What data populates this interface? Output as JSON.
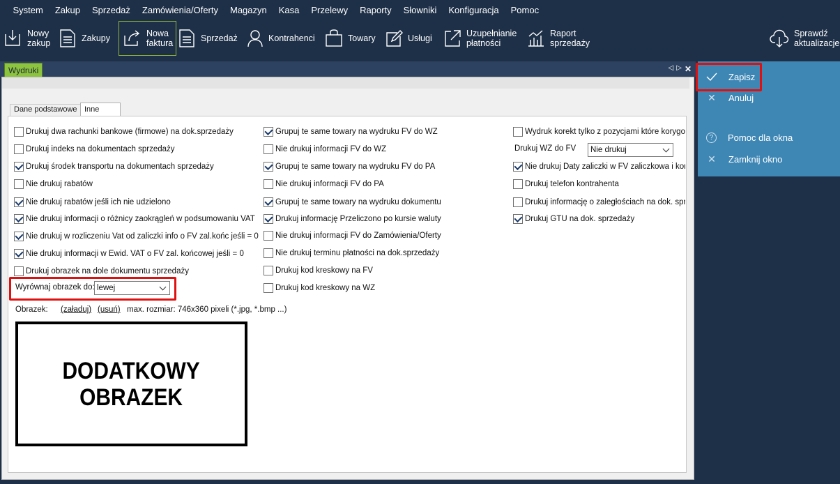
{
  "menu": [
    "System",
    "Zakup",
    "Sprzedaż",
    "Zamówienia/Oferty",
    "Magazyn",
    "Kasa",
    "Przelewy",
    "Raporty",
    "Słowniki",
    "Konfiguracja",
    "Pomoc"
  ],
  "toolbar": {
    "nowy_zakup": "Nowy\nzakup",
    "zakupy": "Zakupy",
    "nowa_faktura": "Nowa\nfaktura",
    "sprzedaz": "Sprzedaż",
    "kontrahenci": "Kontrahenci",
    "towary": "Towary",
    "uslugi": "Usługi",
    "uzupelnianie": "Uzupełnianie\npłatności",
    "raport": "Raport\nsprzedaży",
    "aktualizacje": "Sprawdź\naktualizacje"
  },
  "doc_tab": "Wydruki",
  "subtabs": {
    "basic": "Dane podstawowe",
    "other": "Inne"
  },
  "col1": [
    {
      "label": "Drukuj dwa rachunki bankowe (firmowe) na dok.sprzedaży",
      "checked": false
    },
    {
      "label": "Drukuj indeks na dokumentach sprzedaży",
      "checked": false
    },
    {
      "label": "Drukuj środek transportu na dokumentach sprzedaży",
      "checked": true
    },
    {
      "label": "Nie drukuj rabatów",
      "checked": false
    },
    {
      "label": "Nie drukuj rabatów jeśli ich nie udzielono",
      "checked": true
    },
    {
      "label": "Nie drukuj informacji o różnicy zaokrągleń w podsumowaniu VAT",
      "checked": true
    },
    {
      "label": "Nie drukuj w rozliczeniu Vat od zaliczki info o FV zal.końc jeśli = 0",
      "checked": true
    },
    {
      "label": "Nie drukuj informacji w Ewid. VAT o FV zal. końcowej jeśli = 0",
      "checked": true
    },
    {
      "label": "Drukuj obrazek na dole dokumentu sprzedaży",
      "checked": false
    }
  ],
  "col2": [
    {
      "label": "Grupuj te same towary na wydruku FV do WZ",
      "checked": true
    },
    {
      "label": "Nie drukuj informacji FV do WZ",
      "checked": false
    },
    {
      "label": "Grupuj te same towary na wydruku FV do PA",
      "checked": true
    },
    {
      "label": "Nie drukuj informacji FV do PA",
      "checked": false
    },
    {
      "label": "Grupuj te same towary na wydruku dokumentu",
      "checked": true
    },
    {
      "label": "Drukuj informację Przeliczono po kursie waluty",
      "checked": true
    },
    {
      "label": "Nie drukuj informacji FV do Zamówienia/Oferty",
      "checked": false
    },
    {
      "label": "Nie drukuj terminu płatności na dok.sprzedaży",
      "checked": false
    },
    {
      "label": "Drukuj kod kreskowy na FV",
      "checked": false
    },
    {
      "label": "Drukuj kod kreskowy na WZ",
      "checked": false
    }
  ],
  "col3": [
    {
      "label": "Wydruk korekt tylko z pozycjami które korygo",
      "checked": false
    },
    {
      "label": "Nie drukuj Daty zaliczki w FV zaliczkowa i kor",
      "checked": true
    },
    {
      "label": "Drukuj telefon kontrahenta",
      "checked": false
    },
    {
      "label": "Drukuj informację o zaległościach na dok. sprz",
      "checked": false
    },
    {
      "label": "Drukuj GTU na dok. sprzedaży",
      "checked": true
    }
  ],
  "wz_do_fv": {
    "label": "Drukuj WZ do FV",
    "value": "Nie drukuj"
  },
  "align": {
    "label": "Wyrównaj obrazek do:",
    "value": "lewej"
  },
  "image": {
    "label": "Obrazek:",
    "load": "(załaduj)",
    "remove": "(usuń)",
    "info": "max. rozmiar: 746x360 pixeli (*.jpg, *.bmp ...)",
    "line1": "DODATKOWY",
    "line2": "OBRAZEK"
  },
  "side": {
    "save": "Zapisz",
    "cancel": "Anuluj",
    "help": "Pomoc dla okna",
    "close": "Zamknij okno"
  },
  "colors": {
    "background": "#1e3048",
    "accent": "#8cc33f",
    "side_panel": "#3e87b5",
    "highlight": "#e01010"
  }
}
